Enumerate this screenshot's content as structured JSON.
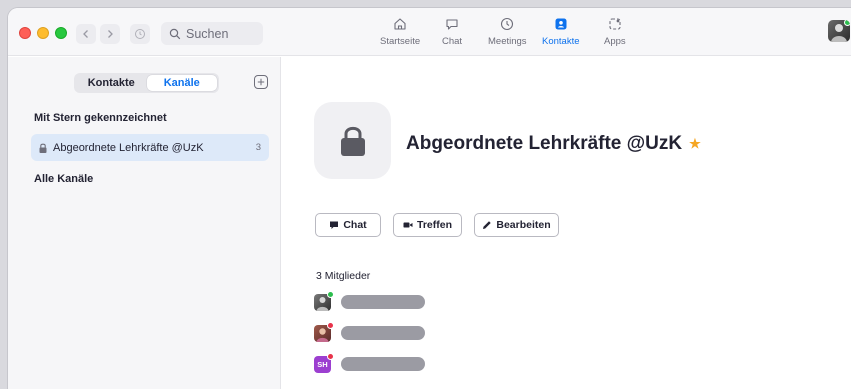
{
  "titlebar": {
    "search_placeholder": "Suchen",
    "tabs": [
      {
        "label": "Startseite",
        "icon": "home-icon"
      },
      {
        "label": "Chat",
        "icon": "chat-bubble-icon"
      },
      {
        "label": "Meetings",
        "icon": "clock-icon"
      },
      {
        "label": "Kontakte",
        "icon": "contacts-icon"
      },
      {
        "label": "Apps",
        "icon": "apps-icon"
      }
    ],
    "active_tab": "Kontakte"
  },
  "sidebar": {
    "segments": [
      "Kontakte",
      "Kanäle"
    ],
    "active_segment": "Kanäle",
    "starred_title": "Mit Stern gekennzeichnet",
    "starred_channels": [
      {
        "name": "Abgeordnete Lehrkräfte @UzK",
        "count": "3",
        "icon": "lock-icon"
      }
    ],
    "all_channels_title": "Alle Kanäle"
  },
  "channel": {
    "title": "Abgeordnete Lehrkräfte @UzK",
    "starred": true,
    "actions": [
      {
        "label": "Chat",
        "icon": "chat-icon"
      },
      {
        "label": "Treffen",
        "icon": "video-camera-icon"
      },
      {
        "label": "Bearbeiten",
        "icon": "pencil-icon"
      }
    ],
    "members_count_label": "3 Mitglieder",
    "members": [
      {
        "initials": "",
        "status": "online"
      },
      {
        "initials": "",
        "status": "busy"
      },
      {
        "initials": "SH",
        "status": "busy"
      }
    ]
  },
  "colors": {
    "accent": "#0e72ed",
    "online": "#2dbd4e",
    "busy": "#e8334a",
    "star": "#f5a623"
  }
}
